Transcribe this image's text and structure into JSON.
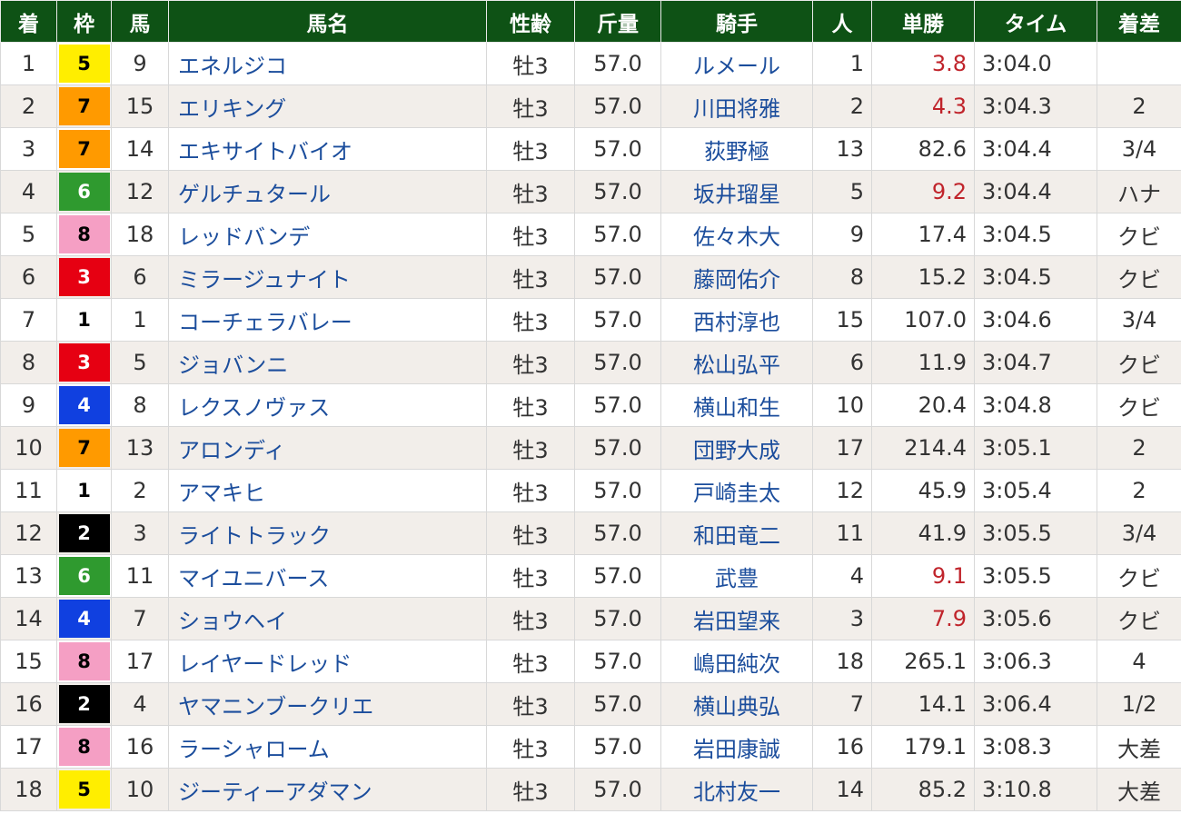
{
  "headers": {
    "rank": "着",
    "waku": "枠",
    "num": "馬",
    "name": "馬名",
    "sex_age": "性齢",
    "weight": "斤量",
    "jockey": "騎手",
    "popularity": "人",
    "odds": "単勝",
    "time": "タイム",
    "margin": "着差"
  },
  "waku_colors": {
    "1": "#ffffff",
    "2": "#000000",
    "3": "#e60012",
    "4": "#1040e0",
    "5": "#ffee00",
    "6": "#2f9a2f",
    "7": "#ff9a00",
    "8": "#f59fc4"
  },
  "odds_highlight_color": "#c0242b",
  "rows": [
    {
      "rank": "1",
      "waku": "5",
      "num": "9",
      "name": "エネルジコ",
      "sex_age": "牡3",
      "weight": "57.0",
      "jockey": "ルメール",
      "popularity": "1",
      "odds": "3.8",
      "time": "3:04.0",
      "margin": ""
    },
    {
      "rank": "2",
      "waku": "7",
      "num": "15",
      "name": "エリキング",
      "sex_age": "牡3",
      "weight": "57.0",
      "jockey": "川田将雅",
      "popularity": "2",
      "odds": "4.3",
      "time": "3:04.3",
      "margin": "2"
    },
    {
      "rank": "3",
      "waku": "7",
      "num": "14",
      "name": "エキサイトバイオ",
      "sex_age": "牡3",
      "weight": "57.0",
      "jockey": "荻野極",
      "popularity": "13",
      "odds": "82.6",
      "time": "3:04.4",
      "margin": "3/4"
    },
    {
      "rank": "4",
      "waku": "6",
      "num": "12",
      "name": "ゲルチュタール",
      "sex_age": "牡3",
      "weight": "57.0",
      "jockey": "坂井瑠星",
      "popularity": "5",
      "odds": "9.2",
      "time": "3:04.4",
      "margin": "ハナ"
    },
    {
      "rank": "5",
      "waku": "8",
      "num": "18",
      "name": "レッドバンデ",
      "sex_age": "牡3",
      "weight": "57.0",
      "jockey": "佐々木大",
      "popularity": "9",
      "odds": "17.4",
      "time": "3:04.5",
      "margin": "クビ"
    },
    {
      "rank": "6",
      "waku": "3",
      "num": "6",
      "name": "ミラージュナイト",
      "sex_age": "牡3",
      "weight": "57.0",
      "jockey": "藤岡佑介",
      "popularity": "8",
      "odds": "15.2",
      "time": "3:04.5",
      "margin": "クビ"
    },
    {
      "rank": "7",
      "waku": "1",
      "num": "1",
      "name": "コーチェラバレー",
      "sex_age": "牡3",
      "weight": "57.0",
      "jockey": "西村淳也",
      "popularity": "15",
      "odds": "107.0",
      "time": "3:04.6",
      "margin": "3/4"
    },
    {
      "rank": "8",
      "waku": "3",
      "num": "5",
      "name": "ジョバンニ",
      "sex_age": "牡3",
      "weight": "57.0",
      "jockey": "松山弘平",
      "popularity": "6",
      "odds": "11.9",
      "time": "3:04.7",
      "margin": "クビ"
    },
    {
      "rank": "9",
      "waku": "4",
      "num": "8",
      "name": "レクスノヴァス",
      "sex_age": "牡3",
      "weight": "57.0",
      "jockey": "横山和生",
      "popularity": "10",
      "odds": "20.4",
      "time": "3:04.8",
      "margin": "クビ"
    },
    {
      "rank": "10",
      "waku": "7",
      "num": "13",
      "name": "アロンディ",
      "sex_age": "牡3",
      "weight": "57.0",
      "jockey": "団野大成",
      "popularity": "17",
      "odds": "214.4",
      "time": "3:05.1",
      "margin": "2"
    },
    {
      "rank": "11",
      "waku": "1",
      "num": "2",
      "name": "アマキヒ",
      "sex_age": "牡3",
      "weight": "57.0",
      "jockey": "戸崎圭太",
      "popularity": "12",
      "odds": "45.9",
      "time": "3:05.4",
      "margin": "2"
    },
    {
      "rank": "12",
      "waku": "2",
      "num": "3",
      "name": "ライトトラック",
      "sex_age": "牡3",
      "weight": "57.0",
      "jockey": "和田竜二",
      "popularity": "11",
      "odds": "41.9",
      "time": "3:05.5",
      "margin": "3/4"
    },
    {
      "rank": "13",
      "waku": "6",
      "num": "11",
      "name": "マイユニバース",
      "sex_age": "牡3",
      "weight": "57.0",
      "jockey": "武豊",
      "popularity": "4",
      "odds": "9.1",
      "time": "3:05.5",
      "margin": "クビ"
    },
    {
      "rank": "14",
      "waku": "4",
      "num": "7",
      "name": "ショウヘイ",
      "sex_age": "牡3",
      "weight": "57.0",
      "jockey": "岩田望来",
      "popularity": "3",
      "odds": "7.9",
      "time": "3:05.6",
      "margin": "クビ"
    },
    {
      "rank": "15",
      "waku": "8",
      "num": "17",
      "name": "レイヤードレッド",
      "sex_age": "牡3",
      "weight": "57.0",
      "jockey": "嶋田純次",
      "popularity": "18",
      "odds": "265.1",
      "time": "3:06.3",
      "margin": "4"
    },
    {
      "rank": "16",
      "waku": "2",
      "num": "4",
      "name": "ヤマニンブークリエ",
      "sex_age": "牡3",
      "weight": "57.0",
      "jockey": "横山典弘",
      "popularity": "7",
      "odds": "14.1",
      "time": "3:06.4",
      "margin": "1/2"
    },
    {
      "rank": "17",
      "waku": "8",
      "num": "16",
      "name": "ラーシャローム",
      "sex_age": "牡3",
      "weight": "57.0",
      "jockey": "岩田康誠",
      "popularity": "16",
      "odds": "179.1",
      "time": "3:08.3",
      "margin": "大差"
    },
    {
      "rank": "18",
      "waku": "5",
      "num": "10",
      "name": "ジーティーアダマン",
      "sex_age": "牡3",
      "weight": "57.0",
      "jockey": "北村友一",
      "popularity": "14",
      "odds": "85.2",
      "time": "3:10.8",
      "margin": "大差"
    }
  ]
}
